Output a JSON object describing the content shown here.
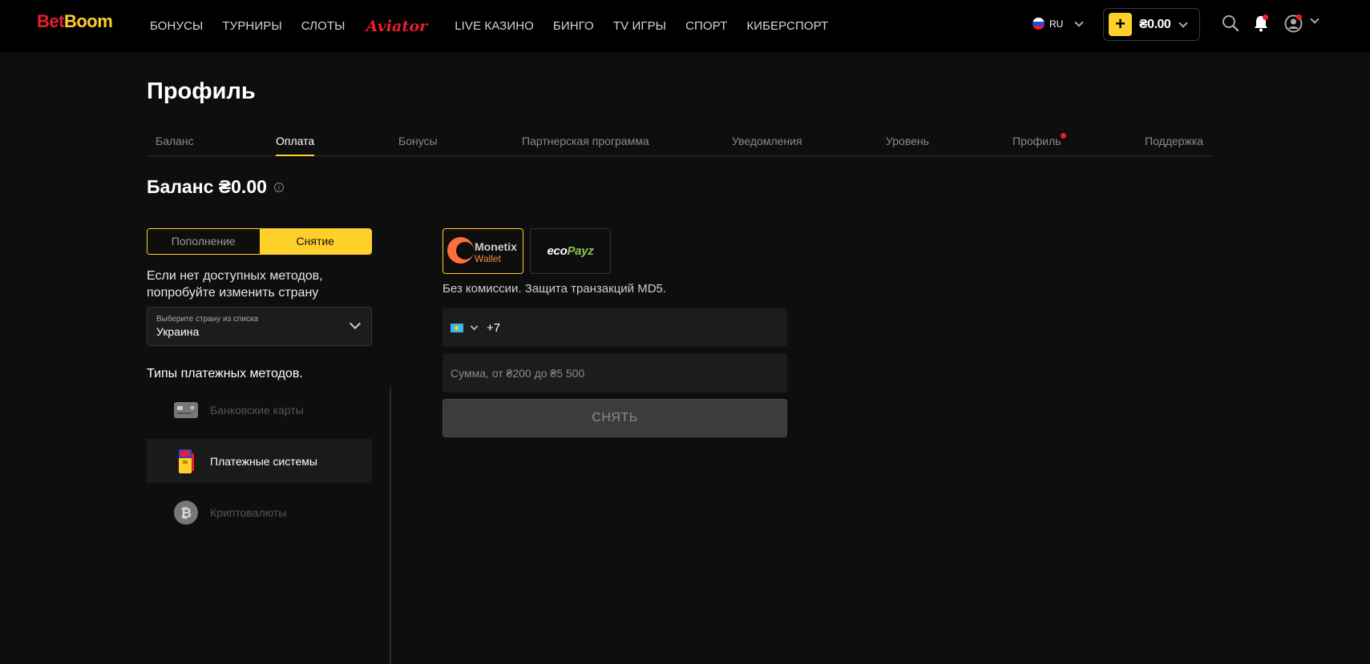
{
  "header": {
    "logo_bet": "Bet",
    "logo_boom": "Boom",
    "nav": [
      "БОНУСЫ",
      "ТУРНИРЫ",
      "СЛОТЫ",
      "Aviator",
      "LIVE КАЗИНО",
      "БИНГО",
      "TV ИГРЫ",
      "СПОРТ",
      "КИБЕРСПОРТ"
    ],
    "language": "RU",
    "wallet_plus": "+",
    "wallet_amount": "₴0.00"
  },
  "page": {
    "title": "Профиль",
    "tabs": [
      "Баланс",
      "Оплата",
      "Бонусы",
      "Партнерская программа",
      "Уведомления",
      "Уровень",
      "Профиль",
      "Поддержка"
    ],
    "active_tab": "Оплата",
    "balance_title": "Баланс ₴0.00",
    "info_glyph": "i"
  },
  "payment": {
    "toggle": {
      "deposit": "Пополнение",
      "withdraw": "Снятие",
      "active": "Снятие"
    },
    "hint": "Если нет доступных методов, попробуйте изменить страну",
    "country": {
      "label": "Выберите страну из списка",
      "value": "Украина"
    },
    "types_title": "Типы платежных методов.",
    "methods": [
      {
        "label": "Банковские карты",
        "icon": "bank-card-icon",
        "active": false
      },
      {
        "label": "Платежные системы",
        "icon": "payment-terminal-icon",
        "active": true
      },
      {
        "label": "Криптовалюты",
        "icon": "bitcoin-icon",
        "active": false
      }
    ],
    "providers": [
      {
        "name1": "Monetix",
        "name2": "Wallet",
        "selected": true
      },
      {
        "name_a": "eco",
        "name_b": "Payz",
        "selected": false
      }
    ],
    "no_fee": "Без комиссии. Защита транзакций MD5.",
    "phone_code": "+7",
    "amount_placeholder": "Сумма, от ₴200 до ₴5 500",
    "submit": "СНЯТЬ"
  },
  "colors": {
    "accent": "#ffd02a",
    "brand_red": "#e8202e",
    "bg": "#0e0e0e"
  }
}
